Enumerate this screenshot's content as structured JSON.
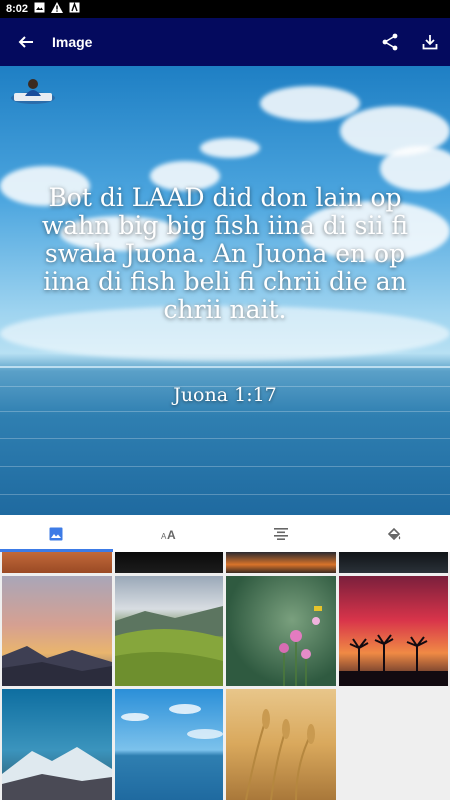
{
  "status": {
    "time": "8:02"
  },
  "appbar": {
    "title": "Image"
  },
  "preview": {
    "verse": "Bot di LAAD did don lain op wahn big big fish iina di sii fi swala Juona. An Juona en op iina di fish beli fi chrii die an chrii nait.",
    "reference": "Juona 1:17"
  },
  "tabs": [
    {
      "icon": "image-icon",
      "active": true
    },
    {
      "icon": "font-size-icon",
      "active": false
    },
    {
      "icon": "align-center-icon",
      "active": false
    },
    {
      "icon": "paint-bucket-icon",
      "active": false
    }
  ],
  "backgrounds": [
    "desert",
    "night",
    "sunset-water",
    "dark-sea",
    "pink-dusk-mountains",
    "green-hills",
    "flowers",
    "palm-sunset",
    "snow-mountain",
    "blue-sea",
    "wheat"
  ],
  "colors": {
    "appbar": "#040a5e",
    "tab_accent": "#3d7be6"
  }
}
